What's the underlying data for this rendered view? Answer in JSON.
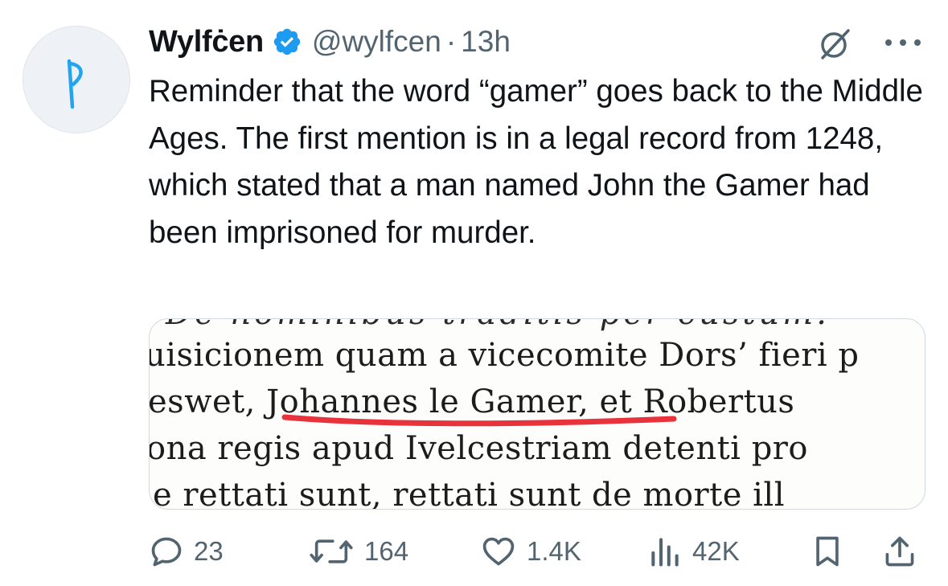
{
  "tweet": {
    "author_name": "Wylfċen",
    "handle": "@wylfcen",
    "separator": "·",
    "time": "13h",
    "avatar_glyph": "ᚹ",
    "text": "Reminder that the word “gamer” goes back to the Middle Ages. The first mention is in a legal record from 1248, which stated that a man named John the Gamer had been imprisoned for murder."
  },
  "media": {
    "lines": [
      "De nominibus traditis per custum.",
      "uisicionem quam a vicecomite Dors’ fieri p",
      "eswet, Johannes le Gamer, et Robertus",
      "ona regis apud Ivelcestriam detenti pro",
      "e rettati sunt, rettati sunt de morte ill"
    ],
    "highlight_color": "#e8323c"
  },
  "actions": {
    "replies": "23",
    "reposts": "164",
    "likes": "1.4K",
    "views": "42K"
  },
  "icons": {
    "verified": "verified-badge-icon",
    "grok": "grok-icon",
    "more": "more-icon",
    "reply": "reply-icon",
    "repost": "repost-icon",
    "like": "like-icon",
    "views": "views-icon",
    "bookmark": "bookmark-icon",
    "share": "share-icon"
  },
  "colors": {
    "verified": "#1d9bf0",
    "secondary_text": "#536471",
    "avatar_glyph": "#1da1f2"
  }
}
